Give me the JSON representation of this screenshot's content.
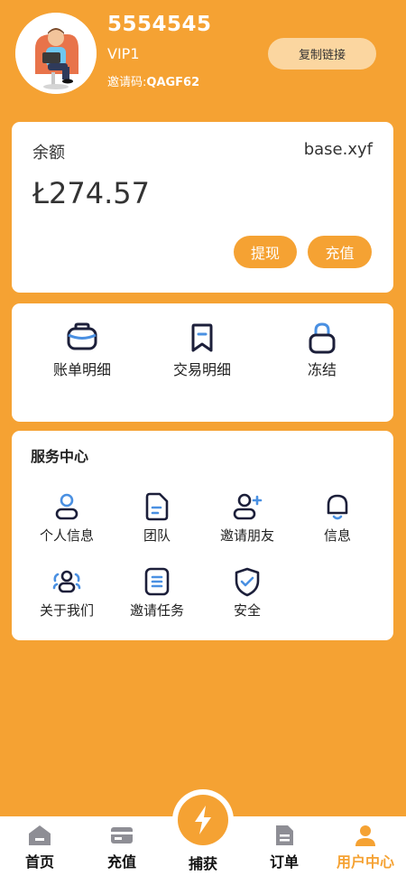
{
  "profile": {
    "username": "5554545",
    "level": "VIP1",
    "invite_label": "邀请码:",
    "invite_code": "QAGF62",
    "copy_link": "复制链接"
  },
  "balance": {
    "label": "余额",
    "site": "base.xyf",
    "amount": "Ł274.57",
    "withdraw": "提现",
    "recharge": "充值"
  },
  "quick": [
    {
      "label": "账单明细",
      "icon": "wallet-icon"
    },
    {
      "label": "交易明细",
      "icon": "bookmark-icon"
    },
    {
      "label": "冻结",
      "icon": "lock-icon"
    }
  ],
  "service": {
    "title": "服务中心",
    "items": [
      {
        "label": "个人信息",
        "icon": "user-icon"
      },
      {
        "label": "团队",
        "icon": "document-icon"
      },
      {
        "label": "邀请朋友",
        "icon": "add-user-icon"
      },
      {
        "label": "信息",
        "icon": "bell-icon"
      },
      {
        "label": "关于我们",
        "icon": "group-icon"
      },
      {
        "label": "邀请任务",
        "icon": "task-icon"
      },
      {
        "label": "安全",
        "icon": "shield-icon"
      }
    ]
  },
  "nav": {
    "home": "首页",
    "recharge": "充值",
    "capture": "捕获",
    "orders": "订单",
    "user_center": "用户中心"
  },
  "colors": {
    "accent": "#F5A233",
    "icon_blue": "#4A90E2",
    "icon_dark": "#1C1F3A"
  }
}
